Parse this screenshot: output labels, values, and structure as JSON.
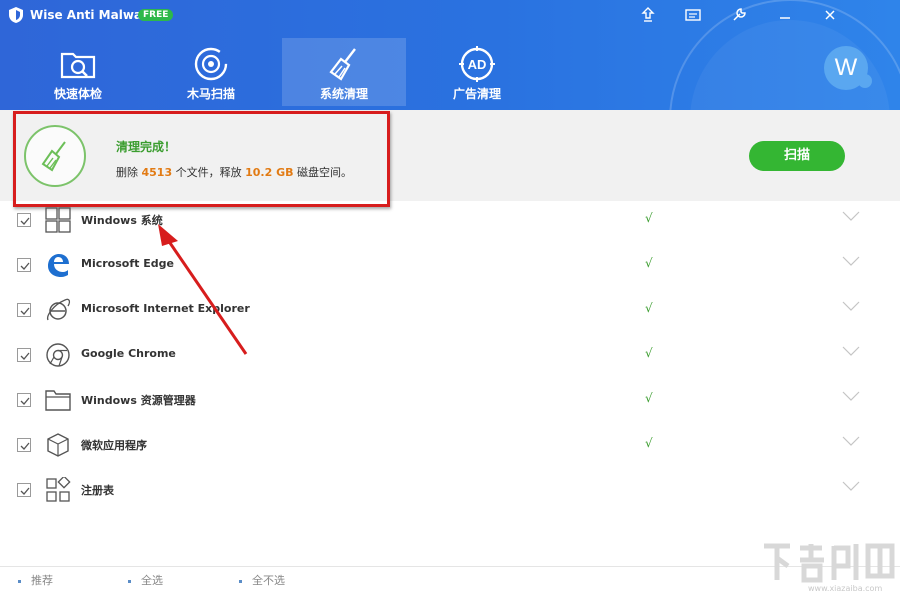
{
  "app": {
    "name": "Wise Anti Malware",
    "badge": "FREE"
  },
  "titlebar": {
    "buttons": [
      "upload-icon",
      "feedback-icon",
      "tools-icon",
      "minimize-icon",
      "close-icon"
    ]
  },
  "nav": [
    {
      "label": "快速体检",
      "icon": "folder-search-icon"
    },
    {
      "label": "木马扫描",
      "icon": "radar-icon"
    },
    {
      "label": "系统清理",
      "icon": "broom-icon",
      "active": true
    },
    {
      "label": "广告清理",
      "icon": "ad-icon"
    }
  ],
  "avatar": {
    "letter": "W"
  },
  "summary": {
    "title": "清理完成！",
    "desc_prefix": "删除",
    "file_count": "4513",
    "desc_middle": "个文件，释放",
    "size": "10.2 GB",
    "desc_suffix": "磁盘空间。",
    "scan_button": "扫描"
  },
  "items": [
    {
      "label": "Windows 系统",
      "icon": "windows-icon",
      "checked": true,
      "status": "√"
    },
    {
      "label": "Microsoft Edge",
      "icon": "edge-icon",
      "checked": true,
      "status": "√"
    },
    {
      "label": "Microsoft Internet Explorer",
      "icon": "ie-icon",
      "checked": true,
      "status": "√"
    },
    {
      "label": "Google Chrome",
      "icon": "chrome-icon",
      "checked": true,
      "status": "√"
    },
    {
      "label": "Windows 资源管理器",
      "icon": "explorer-folder-icon",
      "checked": true,
      "status": "√"
    },
    {
      "label": "微软应用程序",
      "icon": "cube-icon",
      "checked": true,
      "status": "√"
    },
    {
      "label": "注册表",
      "icon": "registry-icon",
      "checked": true,
      "status": ""
    }
  ],
  "footer": {
    "recommend": "推荐",
    "select_all": "全选",
    "select_none": "全不选"
  },
  "watermark": {
    "url": "www.xiazaiba.com"
  },
  "colors": {
    "header": "#2a6fe0",
    "accent_green": "#34b633",
    "highlight_orange": "#e27b14",
    "annotation_red": "#d71d1d"
  }
}
